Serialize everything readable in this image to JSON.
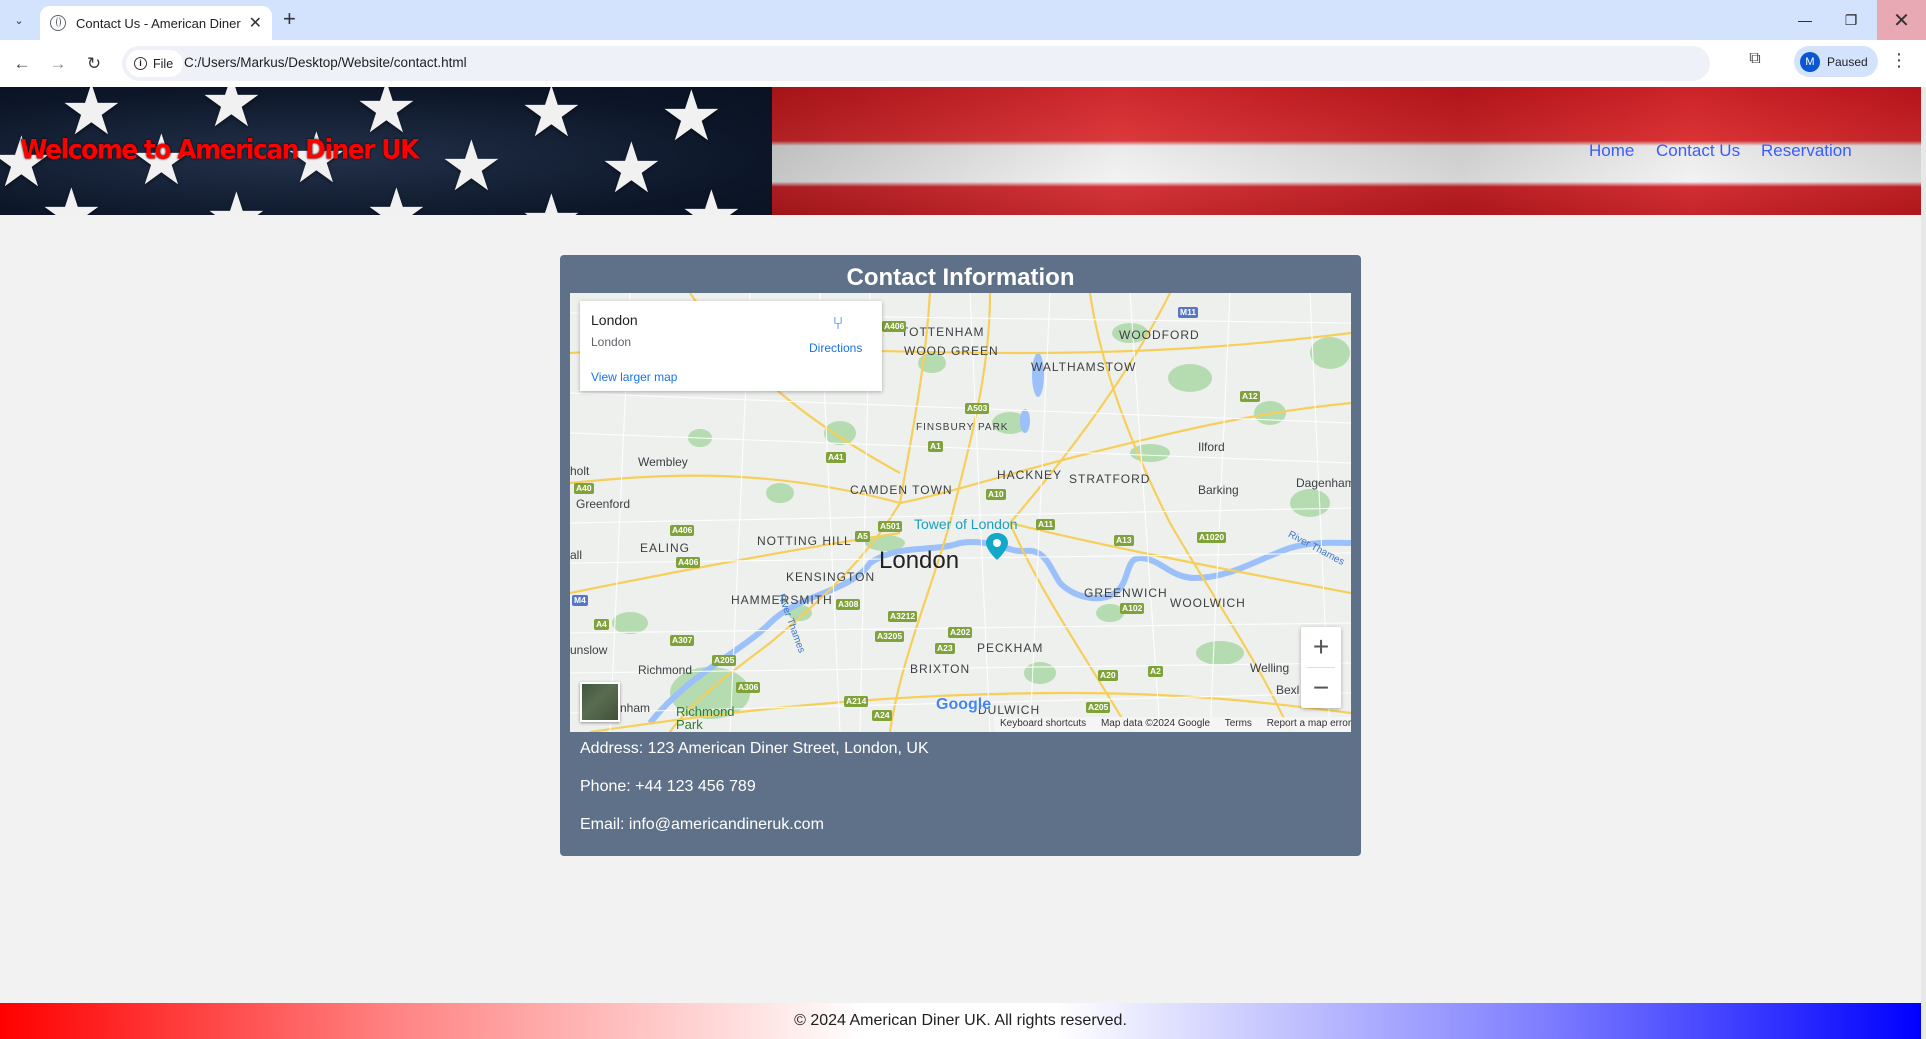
{
  "browser": {
    "tab_title": "Contact Us - American Diner UK",
    "url_chip": "File",
    "url": "C:/Users/Markus/Desktop/Website/contact.html",
    "profile_initial": "M",
    "profile_status": "Paused"
  },
  "site": {
    "title": "Welcome to American Diner UK",
    "nav": {
      "home": "Home",
      "contact": "Contact Us",
      "reservation": "Reservation"
    }
  },
  "contact": {
    "heading": "Contact Information",
    "address": "Address: 123 American Diner Street, London, UK",
    "phone": "Phone: +44 123 456 789",
    "email": "Email: info@americandineruk.com"
  },
  "map": {
    "place_title": "London",
    "place_subtitle": "London",
    "directions": "Directions",
    "larger_map": "View larger map",
    "city_label": "London",
    "poi": "Tower of London",
    "google": "Google",
    "footer": {
      "shortcuts": "Keyboard shortcuts",
      "map_data": "Map data ©2024 Google",
      "terms": "Terms",
      "report": "Report a map error"
    },
    "labels": {
      "tottenham": "TOTTENHAM",
      "woodford": "WOODFORD",
      "wood_green": "WOOD GREEN",
      "walthamstow": "WALTHAMSTOW",
      "finsbury_park": "FINSBURY PARK",
      "ilford": "Ilford",
      "wembley": "Wembley",
      "hackney": "HACKNEY",
      "stratford": "STRATFORD",
      "dagenham": "Dagenham",
      "camden_town": "CAMDEN TOWN",
      "barking": "Barking",
      "greenford": "Greenford",
      "notting_hill": "NOTTING HILL",
      "ealing": "EALING",
      "kensington": "KENSINGTON",
      "hammersmith": "HAMMERSMITH",
      "greenwich": "GREENWICH",
      "woolwich": "WOOLWICH",
      "peckham": "PECKHAM",
      "brixton": "BRIXTON",
      "richmond": "Richmond",
      "richmond_park": "Richmond Park",
      "welling": "Welling",
      "dulwich": "DULWICH",
      "river_thames": "River Thames",
      "holt": "holt",
      "ealing_frag": "all",
      "hounslow": "unslow",
      "nham": "nham",
      "bexl": "Bexl"
    },
    "roads": [
      "A406",
      "M11",
      "A503",
      "A12",
      "A1",
      "A41",
      "A40",
      "A406",
      "A10",
      "A501",
      "A5",
      "A11",
      "A13",
      "A1020",
      "A406",
      "M4",
      "A4",
      "A308",
      "A3212",
      "A202",
      "A3205",
      "A307",
      "A205",
      "A23",
      "A102",
      "A306",
      "A214",
      "A24",
      "A20",
      "A2",
      "A205"
    ]
  },
  "footer": {
    "copyright": "© 2024 American Diner UK. All rights reserved."
  },
  "colors": {
    "card_bg": "#5e7189",
    "nav_link": "#3a5bff",
    "title_red": "#ff0000",
    "map_water": "#9cc0f9",
    "map_park": "#b5dbb0"
  }
}
